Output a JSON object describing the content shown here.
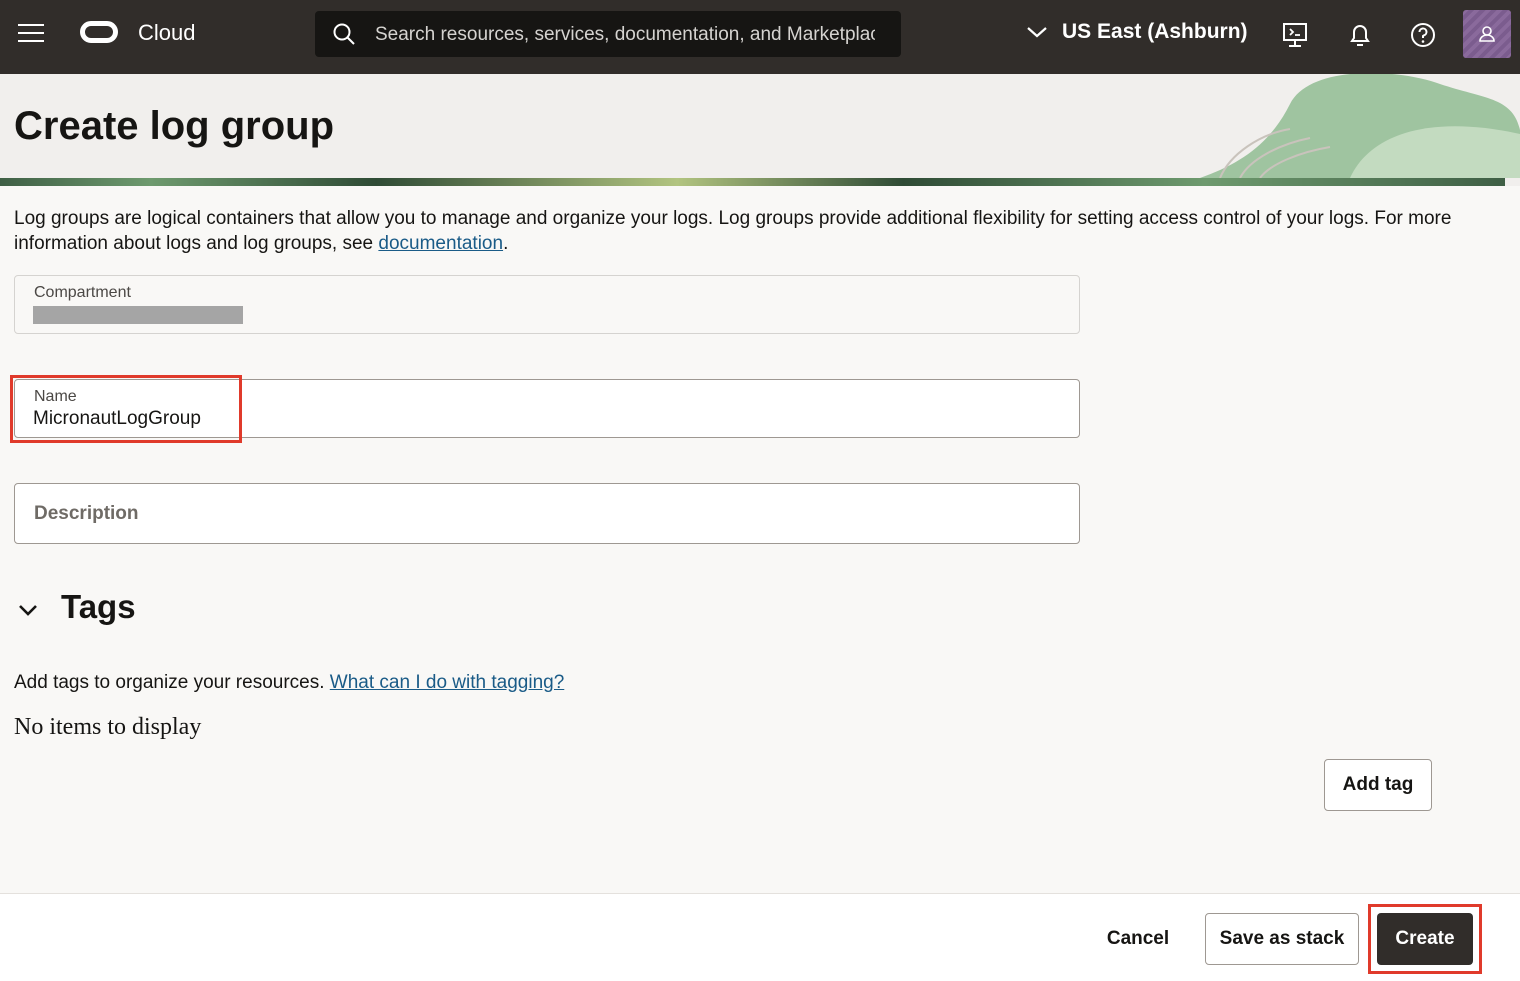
{
  "topbar": {
    "brand": "Cloud",
    "search_placeholder": "Search resources, services, documentation, and Marketplace",
    "region": "US East (Ashburn)"
  },
  "page": {
    "title": "Create log group",
    "intro": "Log groups are logical containers that allow you to manage and organize your logs. Log groups provide additional flexibility for setting access control of your logs. For more information about logs and log groups, see ",
    "intro_link": "documentation",
    "intro_end": "."
  },
  "form": {
    "compartment_label": "Compartment",
    "name_label": "Name",
    "name_value": "MicronautLogGroup",
    "description_placeholder": "Description"
  },
  "tags": {
    "title": "Tags",
    "description": "Add tags to organize your resources. ",
    "help_link": "What can I do with tagging?",
    "empty": "No items to display",
    "add_label": "Add tag"
  },
  "footer": {
    "cancel": "Cancel",
    "save_stack": "Save as stack",
    "create": "Create"
  },
  "colors": {
    "topbar": "#312d2a",
    "highlight": "#e03a2b",
    "link": "#1a5b87"
  }
}
